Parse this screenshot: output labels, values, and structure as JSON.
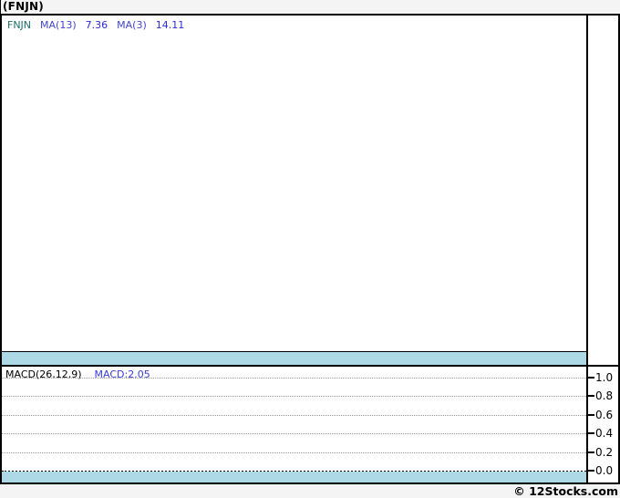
{
  "title": "(FNJN)",
  "price_panel": {
    "legend": [
      {
        "text": "FNJN",
        "color": "#1b6e68"
      },
      {
        "text": "MA(13)",
        "color": "#4444cc"
      },
      {
        "text": "7.36",
        "color": "#2929dd"
      },
      {
        "text": "MA(3)",
        "color": "#4444cc"
      },
      {
        "text": "14.11",
        "color": "#2929dd"
      }
    ]
  },
  "macd_panel": {
    "label": "MACD(26,12,9)",
    "value_label": "MACD:2.05",
    "ticks": [
      "1.0",
      "0.8",
      "0.6",
      "0.4",
      "0.2",
      "0.0"
    ]
  },
  "footer": {
    "credit": "© 12Stocks.com"
  },
  "colors": {
    "page_background": "#f4f4f4",
    "plot_background": "#ffffff",
    "band": "#add8e6",
    "border": "#000000",
    "grid": "#9a9a9a",
    "ticker_teal": "#1b6e68",
    "indicator_blue": "#4444cc",
    "value_blue": "#2929dd"
  },
  "chart_data": [
    {
      "type": "line",
      "panel": "price",
      "ticker": "FNJN",
      "indicators": [
        {
          "name": "MA(13)",
          "value": 7.36
        },
        {
          "name": "MA(3)",
          "value": 14.11
        }
      ],
      "series": [],
      "note": "price plot area is blank (no candles/lines rendered)"
    },
    {
      "type": "line",
      "panel": "macd",
      "name": "MACD(26,12,9)",
      "macd_value": 2.05,
      "ylim": [
        0.0,
        1.0
      ],
      "yticks": [
        1.0,
        0.8,
        0.6,
        0.4,
        0.2,
        0.0
      ],
      "grid": "horizontal dotted, zero line emphasized",
      "legend_position": "top-left",
      "series": []
    }
  ]
}
